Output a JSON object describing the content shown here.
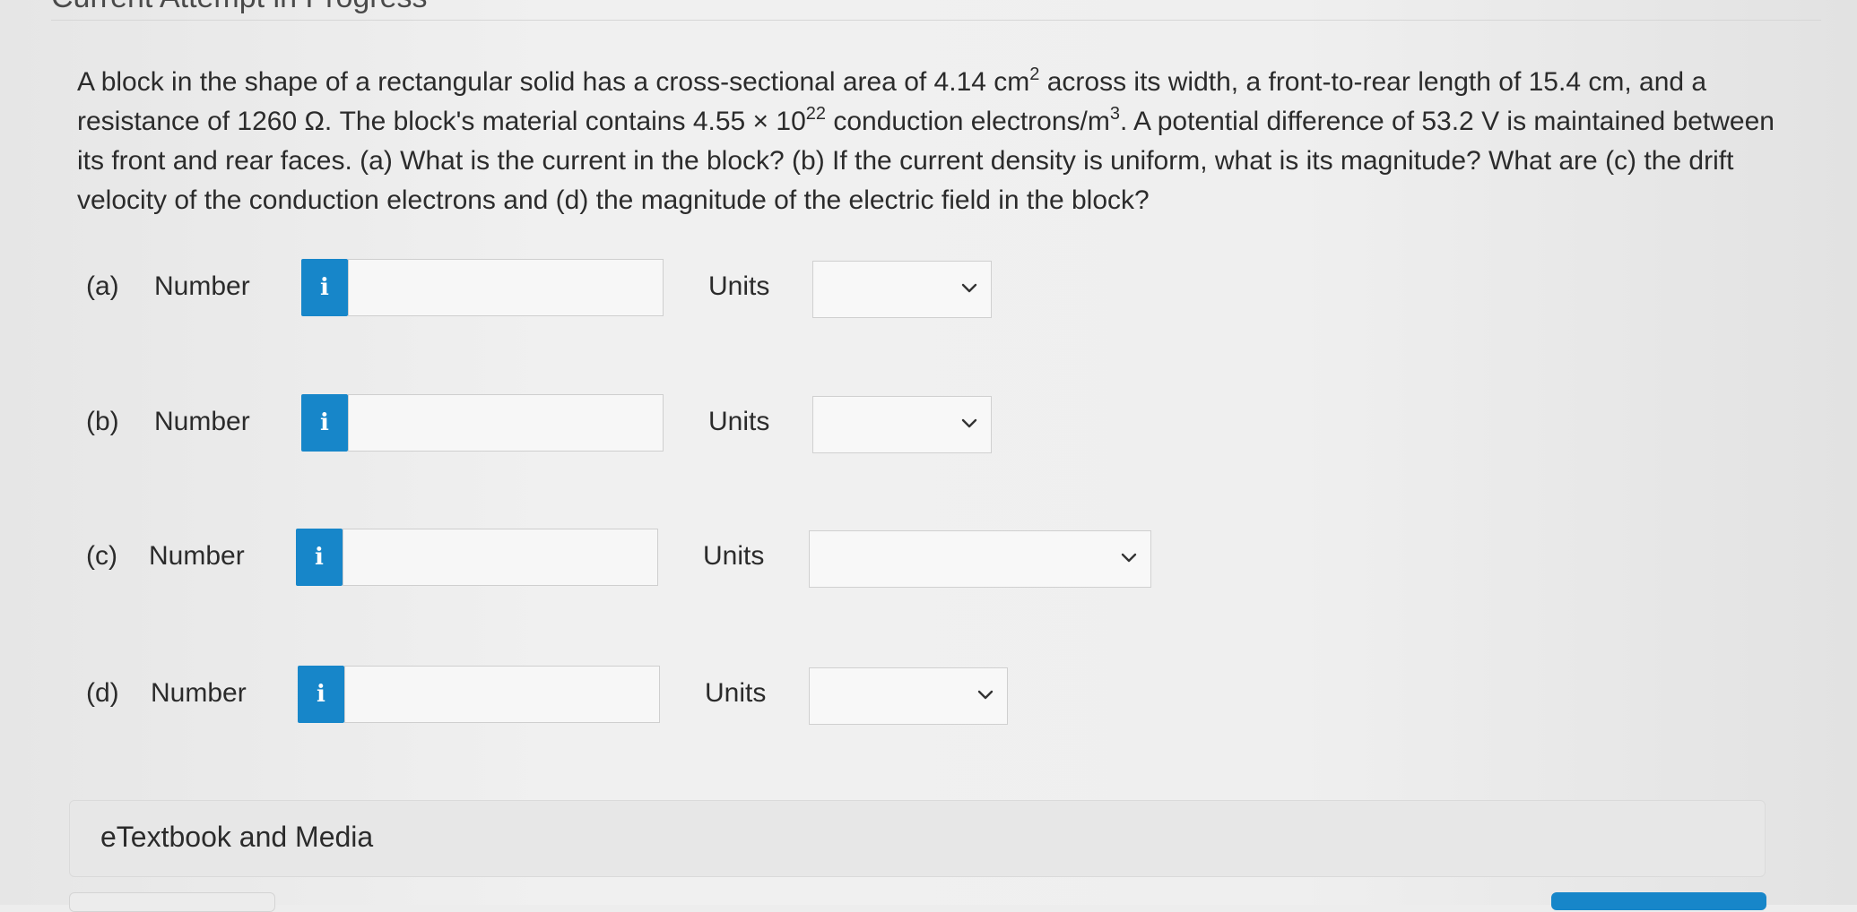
{
  "header": {
    "title": "Current Attempt in Progress"
  },
  "question": {
    "text_1": "A block in the shape of a rectangular solid has a cross-sectional area of 4.14 cm",
    "sup_1": "2",
    "text_2": " across its width, a front-to-rear length of 15.4 cm, and a resistance of 1260 Ω. The block's material contains 4.55 × 10",
    "sup_2": "22",
    "text_3": " conduction electrons/m",
    "sup_3": "3",
    "text_4": ". A potential difference of 53.2 V is maintained between its front and rear faces. (a) What is the current in the block? (b) If the current density is uniform, what is its magnitude? What are (c) the drift velocity of the conduction electrons and (d) the magnitude of the electric field in the block?"
  },
  "answers": [
    {
      "part": "(a)",
      "label": "Number",
      "info_icon": "i",
      "value": "",
      "units_label": "Units",
      "selected_unit": ""
    },
    {
      "part": "(b)",
      "label": "Number",
      "info_icon": "i",
      "value": "",
      "units_label": "Units",
      "selected_unit": ""
    },
    {
      "part": "(c)",
      "label": "Number",
      "info_icon": "i",
      "value": "",
      "units_label": "Units",
      "selected_unit": ""
    },
    {
      "part": "(d)",
      "label": "Number",
      "info_icon": "i",
      "value": "",
      "units_label": "Units",
      "selected_unit": ""
    }
  ],
  "media": {
    "label": "eTextbook and Media"
  }
}
